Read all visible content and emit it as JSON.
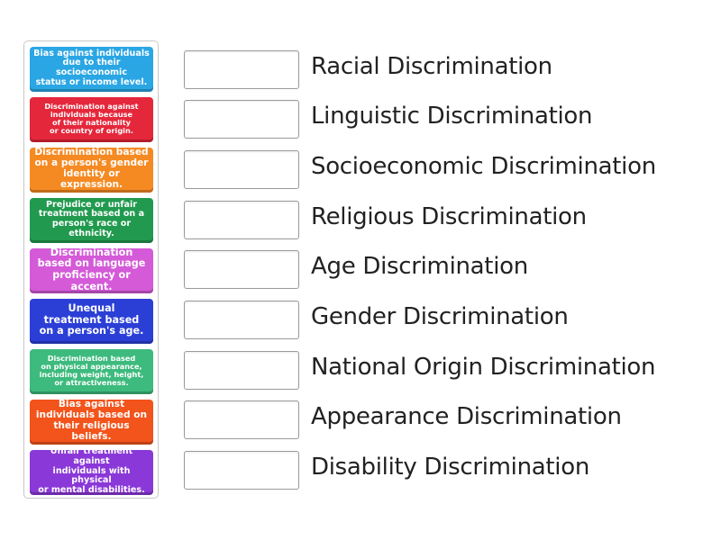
{
  "tiles": [
    {
      "text": "Bias against individuals\ndue to their socioeconomic\nstatus or income level.",
      "color": "#2aa6e4"
    },
    {
      "text": "Discrimination against\nindividuals because\nof their nationality\nor country of origin.",
      "color": "#e5273b"
    },
    {
      "text": "Discrimination based\non a person's gender\nidentity or expression.",
      "color": "#f58a23"
    },
    {
      "text": "Prejudice or unfair\ntreatment based on a\nperson's race or ethnicity.",
      "color": "#219a4f"
    },
    {
      "text": "Discrimination\nbased on language\nproficiency or accent.",
      "color": "#d45ad8"
    },
    {
      "text": "Unequal\ntreatment based\non a person's age.",
      "color": "#2b3fd6"
    },
    {
      "text": "Discrimination based\non physical appearance,\nincluding weight, height,\nor attractiveness.",
      "color": "#3dba7d"
    },
    {
      "text": "Bias against\nindividuals based on\ntheir religious beliefs.",
      "color": "#f2541b"
    },
    {
      "text": "Unfair treatment against\nindividuals with physical\nor mental disabilities.",
      "color": "#8b38d8"
    }
  ],
  "targets": [
    "Racial Discrimination",
    "Linguistic Discrimination",
    "Socioeconomic Discrimination",
    "Religious Discrimination",
    "Age Discrimination",
    "Gender Discrimination",
    "National Origin Discrimination",
    "Appearance Discrimination",
    "Disability Discrimination"
  ]
}
